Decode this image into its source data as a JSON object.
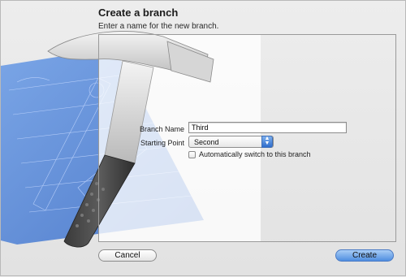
{
  "dialog": {
    "title": "Create a branch",
    "subtitle": "Enter a name for the new branch."
  },
  "form": {
    "branch_name_label": "Branch Name",
    "branch_name_value": "Third",
    "starting_point_label": "Starting Point",
    "starting_point_value": "Second",
    "auto_switch_label": "Automatically switch to this branch",
    "auto_switch_checked": false
  },
  "buttons": {
    "cancel_label": "Cancel",
    "create_label": "Create"
  },
  "icons": {
    "background_art": "xcode-hammer-blueprint-icon",
    "select_arrows": "updown-arrows-icon"
  },
  "colors": {
    "accent": "#4f8ee0",
    "blueprint": "#4a7fd6"
  }
}
